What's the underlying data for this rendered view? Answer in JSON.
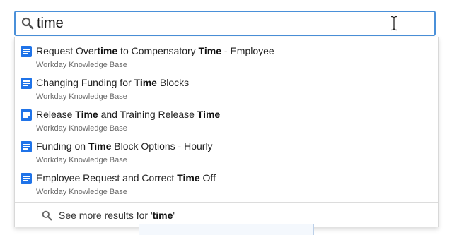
{
  "search": {
    "value": "time",
    "placeholder": ""
  },
  "results": [
    {
      "title_parts": [
        {
          "text": "Request Over",
          "bold": false
        },
        {
          "text": "time",
          "bold": true
        },
        {
          "text": " to Compensatory ",
          "bold": false
        },
        {
          "text": "Time",
          "bold": true
        },
        {
          "text": " - Employee",
          "bold": false
        }
      ],
      "source": "Workday Knowledge Base",
      "icon": "document-icon"
    },
    {
      "title_parts": [
        {
          "text": "Changing Funding for ",
          "bold": false
        },
        {
          "text": "Time",
          "bold": true
        },
        {
          "text": " Blocks",
          "bold": false
        }
      ],
      "source": "Workday Knowledge Base",
      "icon": "document-icon"
    },
    {
      "title_parts": [
        {
          "text": "Release ",
          "bold": false
        },
        {
          "text": "Time",
          "bold": true
        },
        {
          "text": " and Training Release ",
          "bold": false
        },
        {
          "text": "Time",
          "bold": true
        }
      ],
      "source": "Workday Knowledge Base",
      "icon": "document-icon"
    },
    {
      "title_parts": [
        {
          "text": "Funding on ",
          "bold": false
        },
        {
          "text": "Time",
          "bold": true
        },
        {
          "text": " Block Options - Hourly",
          "bold": false
        }
      ],
      "source": "Workday Knowledge Base",
      "icon": "document-icon"
    },
    {
      "title_parts": [
        {
          "text": "Employee Request and Correct ",
          "bold": false
        },
        {
          "text": "Time",
          "bold": true
        },
        {
          "text": " Off",
          "bold": false
        }
      ],
      "source": "Workday Knowledge Base",
      "icon": "document-icon"
    }
  ],
  "see_more": {
    "prefix": "See more results for '",
    "term": "time",
    "suffix": "'",
    "icon": "search-icon"
  },
  "colors": {
    "focus_border": "#4a90d9",
    "doc_icon": "#1f73e8"
  }
}
